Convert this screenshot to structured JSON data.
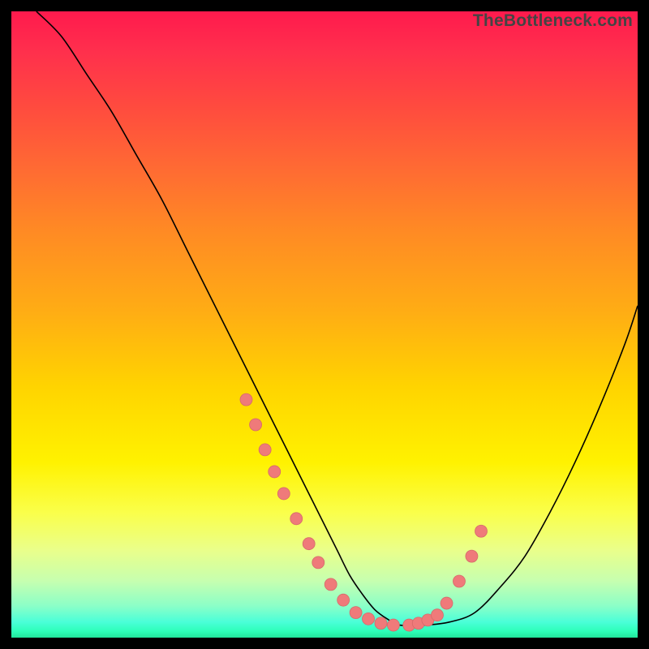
{
  "watermark": "TheBottleneck.com",
  "chart_data": {
    "type": "line",
    "title": "",
    "xlabel": "",
    "ylabel": "",
    "xlim": [
      0,
      100
    ],
    "ylim": [
      0,
      100
    ],
    "series": [
      {
        "name": "bottleneck-curve",
        "x": [
          4,
          8,
          12,
          16,
          20,
          24,
          28,
          32,
          36,
          40,
          44,
          48,
          50,
          52,
          54,
          56,
          58,
          60,
          62,
          66,
          70,
          74,
          78,
          82,
          86,
          90,
          94,
          98,
          100
        ],
        "y": [
          100,
          96,
          90,
          84,
          77,
          70,
          62,
          54,
          46,
          38,
          30,
          22,
          18,
          14,
          10,
          7,
          4.5,
          3,
          2,
          2,
          2.5,
          4,
          8,
          13,
          20,
          28,
          37,
          47,
          53
        ]
      }
    ],
    "markers": {
      "name": "highlight-points",
      "note": "salmon dots near curve minimum on both arms",
      "x": [
        37.5,
        39,
        40.5,
        42,
        43.5,
        45.5,
        47.5,
        49,
        51,
        53,
        55,
        57,
        59,
        61,
        63.5,
        65,
        66.5,
        68,
        69.5,
        71.5,
        73.5,
        75
      ],
      "y": [
        38,
        34,
        30,
        26.5,
        23,
        19,
        15,
        12,
        8.5,
        6,
        4,
        3,
        2.3,
        2,
        2,
        2.3,
        2.8,
        3.6,
        5.5,
        9,
        13,
        17
      ]
    },
    "background": "rainbow-gradient-red-to-green-vertical"
  }
}
